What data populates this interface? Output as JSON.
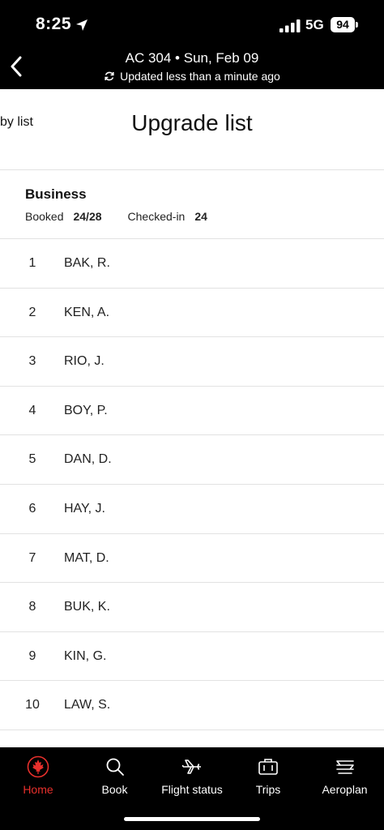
{
  "status_bar": {
    "time": "8:25",
    "network": "5G",
    "battery": "94"
  },
  "header": {
    "flight_title": "AC 304 • Sun, Feb 09",
    "updated_text": "Updated less than a minute ago"
  },
  "page": {
    "left_tab_label": "by list",
    "title": "Upgrade list"
  },
  "cabin": {
    "name": "Business",
    "booked_label": "Booked",
    "booked_value": "24/28",
    "checked_in_label": "Checked-in",
    "checked_in_value": "24"
  },
  "list": [
    {
      "rank": "1",
      "name": "BAK, R."
    },
    {
      "rank": "2",
      "name": "KEN, A."
    },
    {
      "rank": "3",
      "name": "RIO, J."
    },
    {
      "rank": "4",
      "name": "BOY, P."
    },
    {
      "rank": "5",
      "name": "DAN, D."
    },
    {
      "rank": "6",
      "name": "HAY, J."
    },
    {
      "rank": "7",
      "name": "MAT, D."
    },
    {
      "rank": "8",
      "name": "BUK, K."
    },
    {
      "rank": "9",
      "name": "KIN, G."
    },
    {
      "rank": "10",
      "name": "LAW, S."
    }
  ],
  "tab_bar": {
    "home": "Home",
    "book": "Book",
    "flight_status": "Flight status",
    "trips": "Trips",
    "aeroplan": "Aeroplan",
    "active_color": "#e8302c"
  }
}
